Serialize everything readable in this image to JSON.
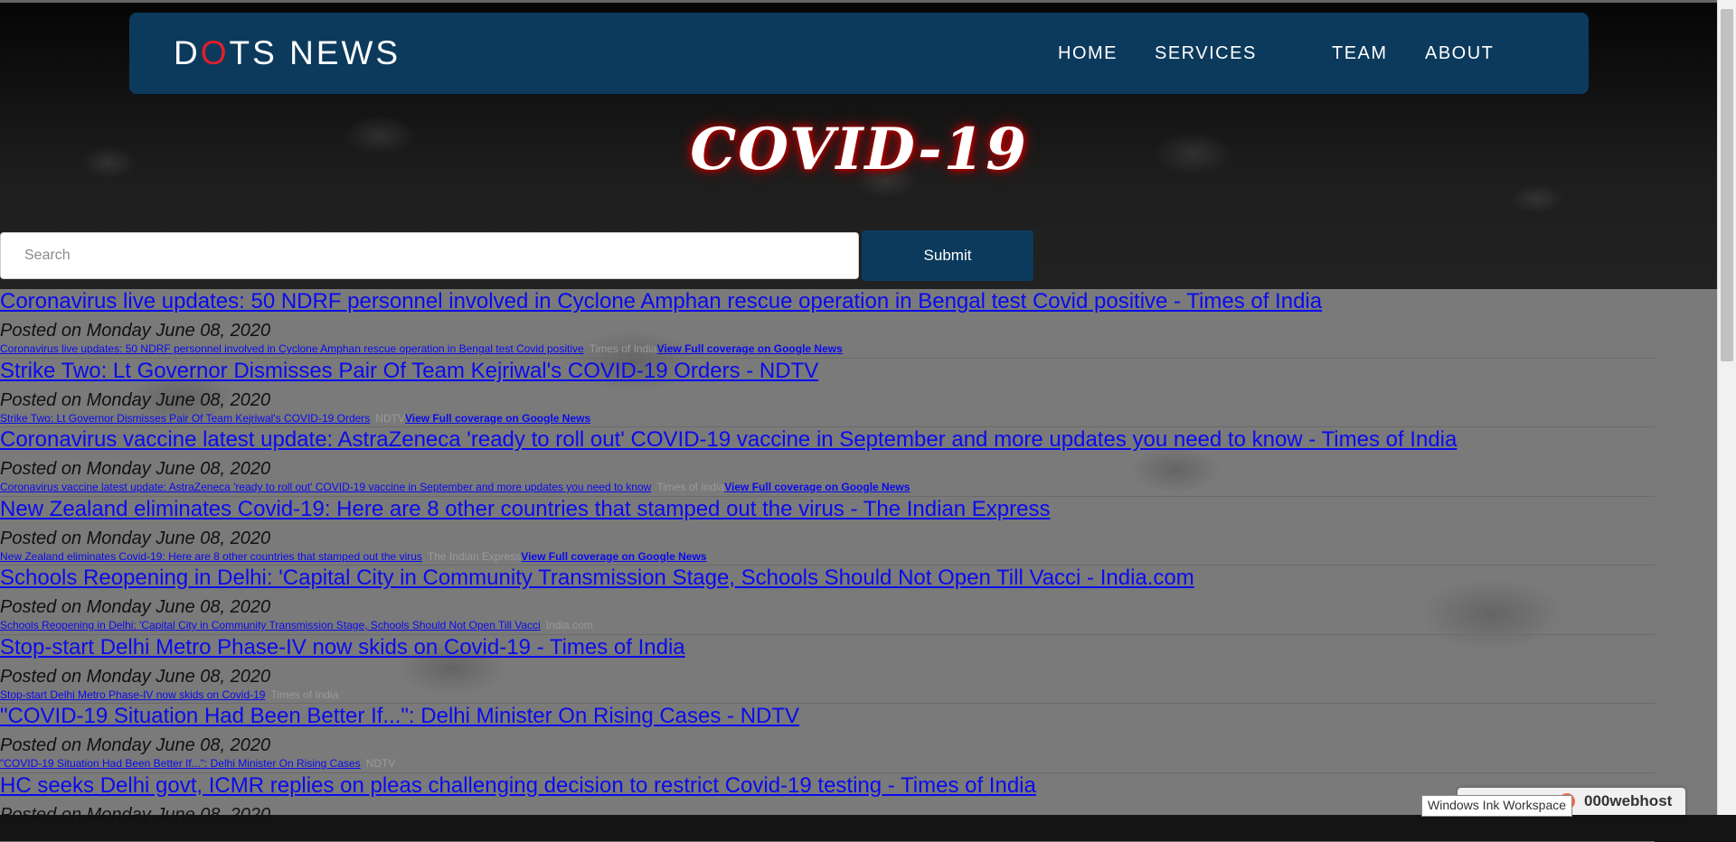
{
  "brand": {
    "logo_d": "D",
    "logo_o": "O",
    "logo_rest": "TS NEWS"
  },
  "nav": {
    "home": "HOME",
    "services": "SERVICES",
    "team": "TEAM",
    "about": "ABOUT"
  },
  "hero": {
    "title": "COVID-19"
  },
  "search": {
    "placeholder": "Search",
    "submit_label": "Submit"
  },
  "news": [
    {
      "headline": "Coronavirus live updates: 50 NDRF personnel involved in Cyclone Amphan rescue operation in Bengal test Covid positive - Times of India",
      "posted": "Posted on Monday June 08, 2020",
      "summary": "Coronavirus live updates: 50 NDRF personnel involved in Cyclone Amphan rescue operation in Bengal test Covid positive",
      "source": "Times of India",
      "coverage": "View Full coverage on Google News"
    },
    {
      "headline": "Strike Two: Lt Governor Dismisses Pair Of Team Kejriwal's COVID-19 Orders - NDTV",
      "posted": "Posted on Monday June 08, 2020",
      "summary": "Strike Two: Lt Governor Dismisses Pair Of Team Kejriwal's COVID-19 Orders",
      "source": "NDTV",
      "coverage": "View Full coverage on Google News"
    },
    {
      "headline": "Coronavirus vaccine latest update: AstraZeneca 'ready to roll out' COVID-19 vaccine in September and more updates you need to know - Times of India",
      "posted": "Posted on Monday June 08, 2020",
      "summary": "Coronavirus vaccine latest update: AstraZeneca 'ready to roll out' COVID-19 vaccine in September and more updates you need to know",
      "source": "Times of India",
      "coverage": "View Full coverage on Google News"
    },
    {
      "headline": "New Zealand eliminates Covid-19: Here are 8 other countries that stamped out the virus - The Indian Express",
      "posted": "Posted on Monday June 08, 2020",
      "summary": "New Zealand eliminates Covid-19: Here are 8 other countries that stamped out the virus",
      "source": "The Indian Express",
      "coverage": "View Full coverage on Google News"
    },
    {
      "headline": "Schools Reopening in Delhi: 'Capital City in Community Transmission Stage, Schools Should Not Open Till Vacci - India.com",
      "posted": "Posted on Monday June 08, 2020",
      "summary": "Schools Reopening in Delhi: 'Capital City in Community Transmission Stage, Schools Should Not Open Till Vacci",
      "source": "India.com",
      "coverage": ""
    },
    {
      "headline": "Stop-start Delhi Metro Phase-IV now skids on Covid-19 - Times of India",
      "posted": "Posted on Monday June 08, 2020",
      "summary": "Stop-start Delhi Metro Phase-IV now skids on Covid-19",
      "source": "Times of India",
      "coverage": ""
    },
    {
      "headline": "\"COVID-19 Situation Had Been Better If...\": Delhi Minister On Rising Cases - NDTV",
      "posted": "Posted on Monday June 08, 2020",
      "summary": "\"COVID-19 Situation Had Been Better If...\": Delhi Minister On Rising Cases",
      "source": "NDTV",
      "coverage": ""
    },
    {
      "headline": "HC seeks Delhi govt, ICMR replies on pleas challenging decision to restrict Covid-19 testing - Times of India",
      "posted": "Posted on Monday June 08, 2020",
      "summary": "",
      "source": "",
      "coverage": ""
    }
  ],
  "footer_badge": {
    "text": "000webhost"
  },
  "tooltip": {
    "text": "Windows Ink Workspace"
  },
  "colors": {
    "navbar": "#0c3a5c",
    "accent_red": "#e0202a",
    "link_blue": "#0a0aee"
  }
}
